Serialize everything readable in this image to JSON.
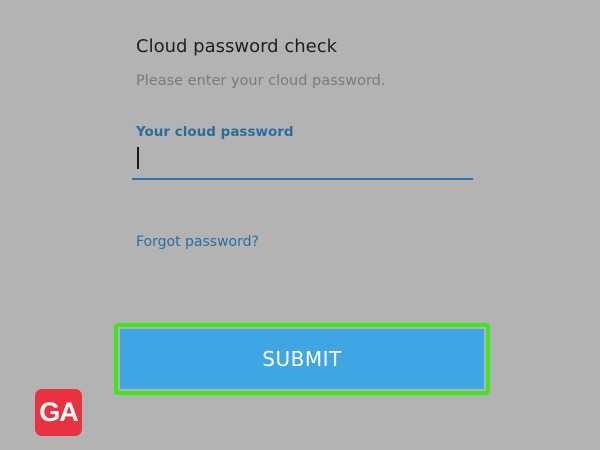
{
  "dialog": {
    "title": "Cloud password check",
    "subtitle": "Please enter your cloud password.",
    "password_field": {
      "label": "Your cloud password",
      "value": "",
      "placeholder": ""
    },
    "forgot_link": "Forgot password?",
    "submit_label": "SUBMIT"
  },
  "watermark": {
    "text": "GA"
  },
  "colors": {
    "background": "#b3b3b3",
    "accent": "#2b6d9e",
    "button": "#3fa6e4",
    "highlight": "#3ee61a",
    "logo": "#e8323f"
  }
}
